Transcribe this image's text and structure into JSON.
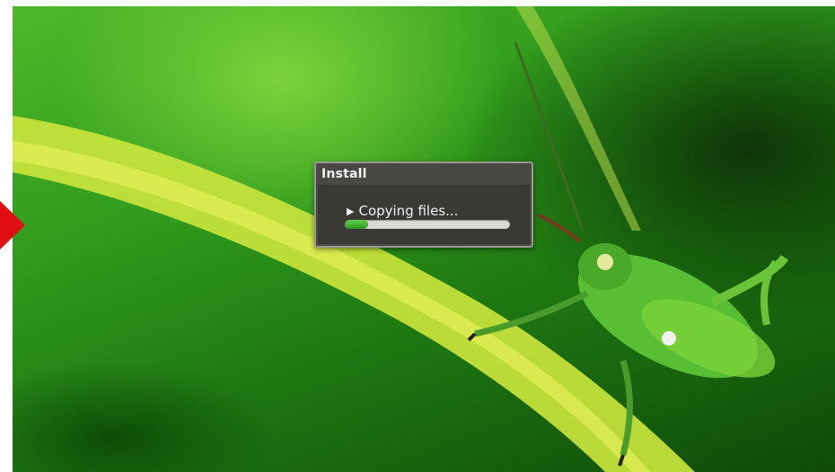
{
  "wallpaper": {
    "subject": "grasshopper-on-leaf",
    "colors": {
      "leaf": "#c8e23a",
      "leaf_dark": "#2f9a1c",
      "insect": "#5cc23a"
    }
  },
  "marker": {
    "icon": "red-arrow-marker-icon",
    "color": "#e11010"
  },
  "dialog": {
    "title": "Install",
    "status_arrow_icon": "play-triangle-icon",
    "status_arrow": "▶",
    "status_text": "Copying files...",
    "progress_percent": 14,
    "colors": {
      "background": "#4a4845",
      "progress_fill": "#3fb82e",
      "progress_track": "#d9d9d6"
    }
  }
}
